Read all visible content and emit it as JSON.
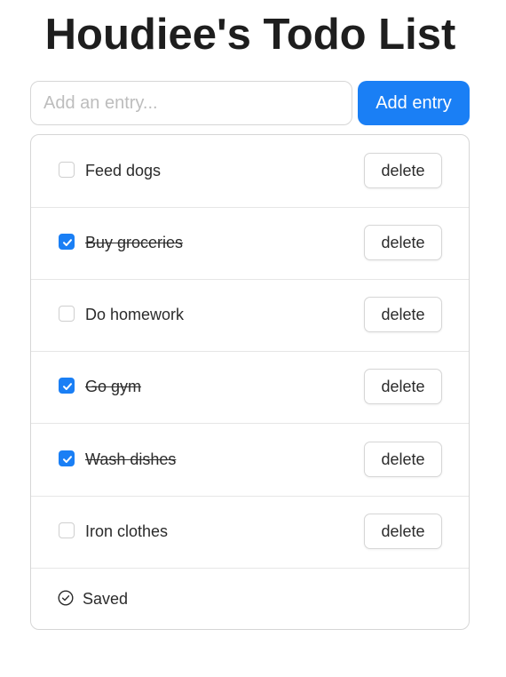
{
  "header": {
    "title": "Houdiee's Todo List"
  },
  "entry": {
    "placeholder": "Add an entry...",
    "value": "",
    "add_label": "Add entry"
  },
  "todos": [
    {
      "text": "Feed dogs",
      "done": false,
      "delete_label": "delete"
    },
    {
      "text": "Buy groceries",
      "done": true,
      "delete_label": "delete"
    },
    {
      "text": "Do homework",
      "done": false,
      "delete_label": "delete"
    },
    {
      "text": "Go gym",
      "done": true,
      "delete_label": "delete"
    },
    {
      "text": "Wash dishes",
      "done": true,
      "delete_label": "delete"
    },
    {
      "text": "Iron clothes",
      "done": false,
      "delete_label": "delete"
    }
  ],
  "status": {
    "text": "Saved",
    "icon": "check-circle-icon"
  },
  "colors": {
    "accent": "#1a7ff5",
    "border": "#d6d6d6"
  }
}
